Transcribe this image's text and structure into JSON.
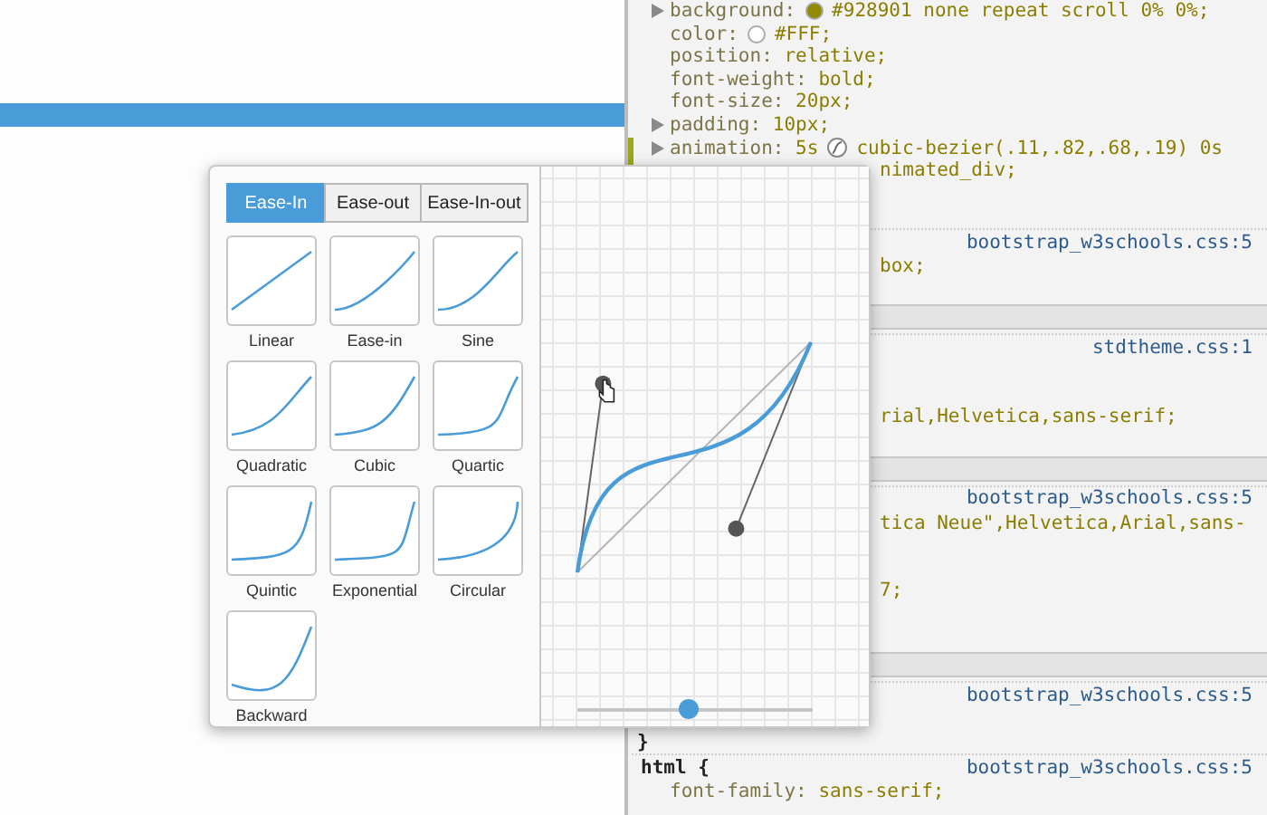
{
  "page": {
    "highlight_bar": true
  },
  "styles_pane": {
    "lines": [
      {
        "kind": "prop-color",
        "expandable": true,
        "changed": false,
        "name": "background:",
        "value": "#928901 none repeat scroll 0% 0%;",
        "color": "#928901"
      },
      {
        "kind": "prop-color",
        "expandable": false,
        "changed": false,
        "name": "color:",
        "value": "#FFF;",
        "color": "#ffffff"
      },
      {
        "kind": "prop",
        "expandable": false,
        "changed": false,
        "name": "position:",
        "value": "relative;"
      },
      {
        "kind": "prop",
        "expandable": false,
        "changed": false,
        "name": "font-weight:",
        "value": "bold;"
      },
      {
        "kind": "prop",
        "expandable": false,
        "changed": false,
        "name": "font-size:",
        "value": "20px;"
      },
      {
        "kind": "prop",
        "expandable": true,
        "changed": false,
        "name": "padding:",
        "value": "10px;"
      },
      {
        "kind": "prop-easing",
        "expandable": true,
        "changed": true,
        "name": "animation:",
        "value_before": "5s",
        "value": "cubic-bezier(.11,.82,.68,.19) 0s"
      },
      {
        "kind": "covered",
        "changed": true,
        "value": "nimated_div;"
      },
      {
        "kind": "gap"
      },
      {
        "kind": "gap"
      },
      {
        "kind": "source",
        "value": "bootstrap_w3schools.css:5"
      },
      {
        "kind": "covered",
        "value": "box;"
      },
      {
        "kind": "gap"
      },
      {
        "kind": "band"
      },
      {
        "kind": "source",
        "value": "stdtheme.css:1"
      },
      {
        "kind": "gap"
      },
      {
        "kind": "gap"
      },
      {
        "kind": "covered",
        "value": "rial,Helvetica,sans-serif;"
      },
      {
        "kind": "gap"
      },
      {
        "kind": "band"
      },
      {
        "kind": "source",
        "value": "bootstrap_w3schools.css:5"
      },
      {
        "kind": "covered",
        "value": "tica Neue\",Helvetica,Arial,sans-"
      },
      {
        "kind": "gap"
      },
      {
        "kind": "gap"
      },
      {
        "kind": "covered",
        "value": "7;"
      },
      {
        "kind": "gap"
      },
      {
        "kind": "gap"
      },
      {
        "kind": "band"
      },
      {
        "kind": "source",
        "value": "bootstrap_w3schools.css:5"
      },
      {
        "kind": "gap"
      },
      {
        "kind": "brace",
        "value": "}"
      },
      {
        "kind": "source",
        "selector": "html {",
        "value": "bootstrap_w3schools.css:5"
      },
      {
        "kind": "prop",
        "expandable": false,
        "changed": false,
        "name": "font-family:",
        "value": "sans-serif;"
      }
    ]
  },
  "easing_editor": {
    "tabs": [
      {
        "label": "Ease-In",
        "selected": true
      },
      {
        "label": "Ease-out",
        "selected": false
      },
      {
        "label": "Ease-In-out",
        "selected": false
      }
    ],
    "presets": [
      {
        "label": "Linear",
        "kind": "linear"
      },
      {
        "label": "Ease-in",
        "kind": "easein"
      },
      {
        "label": "Sine",
        "kind": "sine"
      },
      {
        "label": "Quadratic",
        "kind": "quadratic"
      },
      {
        "label": "Cubic",
        "kind": "cubic"
      },
      {
        "label": "Quartic",
        "kind": "quartic"
      },
      {
        "label": "Quintic",
        "kind": "quintic"
      },
      {
        "label": "Exponential",
        "kind": "exponential"
      },
      {
        "label": "Circular",
        "kind": "circular"
      },
      {
        "label": "Backward",
        "kind": "backward"
      }
    ],
    "slider": {
      "level": 0.47
    }
  }
}
